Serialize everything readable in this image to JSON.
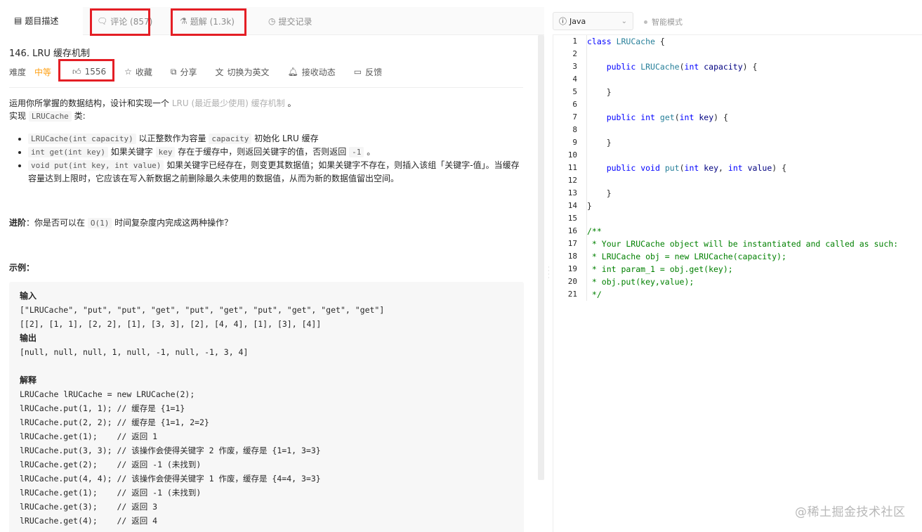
{
  "tabs": [
    {
      "label": "题目描述",
      "icon": "document-icon"
    },
    {
      "label": "评论 (857)",
      "icon": "comment-icon"
    },
    {
      "label": "题解 (1.3k)",
      "icon": "flask-icon"
    },
    {
      "label": "提交记录",
      "icon": "clock-icon"
    }
  ],
  "editor_bar": {
    "language": "Java",
    "smart_mode": "智能模式"
  },
  "problem": {
    "title": "146. LRU 缓存机制",
    "difficulty_label": "难度",
    "difficulty": "中等",
    "likes": "1556",
    "collect": "收藏",
    "share": "分享",
    "switch_lang": "切换为英文",
    "notify": "接收动态",
    "feedback": "反馈"
  },
  "description": {
    "p1_pre": "运用你所掌握的数据结构，设计和实现一个 ",
    "p1_link": "LRU (最近最少使用) 缓存机制",
    "p1_post": " 。",
    "p2_pre": "实现 ",
    "p2_code": "LRUCache",
    "p2_post": " 类:",
    "bullets": [
      {
        "code": "LRUCache(int capacity)",
        "t1": " 以正整数作为容量 ",
        "code2": "capacity",
        "t2": " 初始化 LRU 缓存"
      },
      {
        "code": "int get(int key)",
        "t1": " 如果关键字 ",
        "code2": "key",
        "t2": " 存在于缓存中，则返回关键字的值，否则返回 ",
        "code3": "-1",
        "t3": " 。"
      },
      {
        "code": "void put(int key, int value)",
        "t1": " 如果关键字已经存在，则变更其数据值；如果关键字不存在，则插入该组「关键字-值」。当缓存容量达到上限时，它应该在写入新数据之前删除最久未使用的数据值，从而为新的数据值留出空间。"
      }
    ],
    "advanced_label": "进阶",
    "advanced_pre": "：你是否可以在 ",
    "advanced_code": "O(1)",
    "advanced_post": " 时间复杂度内完成这两种操作？",
    "example_label": "示例："
  },
  "example_lines": [
    {
      "text": "输入",
      "bold": true
    },
    {
      "text": "[\"LRUCache\", \"put\", \"put\", \"get\", \"put\", \"get\", \"put\", \"get\", \"get\", \"get\"]"
    },
    {
      "text": "[[2], [1, 1], [2, 2], [1], [3, 3], [2], [4, 4], [1], [3], [4]]"
    },
    {
      "text": "输出",
      "bold": true
    },
    {
      "text": "[null, null, null, 1, null, -1, null, -1, 3, 4]"
    },
    {
      "text": ""
    },
    {
      "text": "解释",
      "bold": true
    },
    {
      "text": "LRUCache lRUCache = new LRUCache(2);"
    },
    {
      "text": "lRUCache.put(1, 1); // 缓存是 {1=1}"
    },
    {
      "text": "lRUCache.put(2, 2); // 缓存是 {1=1, 2=2}"
    },
    {
      "text": "lRUCache.get(1);    // 返回 1"
    },
    {
      "text": "lRUCache.put(3, 3); // 该操作会使得关键字 2 作废，缓存是 {1=1, 3=3}"
    },
    {
      "text": "lRUCache.get(2);    // 返回 -1 (未找到)"
    },
    {
      "text": "lRUCache.put(4, 4); // 该操作会使得关键字 1 作废，缓存是 {4=4, 3=3}"
    },
    {
      "text": "lRUCache.get(1);    // 返回 -1 (未找到)"
    },
    {
      "text": "lRUCache.get(3);    // 返回 3"
    },
    {
      "text": "lRUCache.get(4);    // 返回 4"
    }
  ],
  "code_lines": [
    {
      "n": "1",
      "html": "<span class='kw'>class</span> <span class='ty'>LRUCache</span> {"
    },
    {
      "n": "2",
      "html": ""
    },
    {
      "n": "3",
      "html": "    <span class='kw'>public</span> <span class='ty'>LRUCache</span>(<span class='kw'>int</span> <span class='cc'>capacity</span>) {"
    },
    {
      "n": "4",
      "html": ""
    },
    {
      "n": "5",
      "html": "    }"
    },
    {
      "n": "6",
      "html": ""
    },
    {
      "n": "7",
      "html": "    <span class='kw'>public</span> <span class='kw'>int</span> <span class='ty'>get</span>(<span class='kw'>int</span> <span class='cc'>key</span>) {"
    },
    {
      "n": "8",
      "html": ""
    },
    {
      "n": "9",
      "html": "    }"
    },
    {
      "n": "10",
      "html": ""
    },
    {
      "n": "11",
      "html": "    <span class='kw'>public</span> <span class='kw'>void</span> <span class='ty'>put</span>(<span class='kw'>int</span> <span class='cc'>key</span>, <span class='kw'>int</span> <span class='cc'>value</span>) {"
    },
    {
      "n": "12",
      "html": ""
    },
    {
      "n": "13",
      "html": "    }"
    },
    {
      "n": "14",
      "html": "}"
    },
    {
      "n": "15",
      "html": ""
    },
    {
      "n": "16",
      "html": "<span class='cm'>/**</span>"
    },
    {
      "n": "17",
      "html": "<span class='cm'> * Your LRUCache object will be instantiated and called as such:</span>"
    },
    {
      "n": "18",
      "html": "<span class='cm'> * LRUCache obj = new LRUCache(capacity);</span>"
    },
    {
      "n": "19",
      "html": "<span class='cm'> * int param_1 = obj.get(key);</span>"
    },
    {
      "n": "20",
      "html": "<span class='cm'> * obj.put(key,value);</span>"
    },
    {
      "n": "21",
      "html": "<span class='cm'> */</span>"
    }
  ],
  "watermark": "@稀土掘金技术社区",
  "colors": {
    "accent_red": "#e41e25",
    "medium": "#ffa116"
  }
}
